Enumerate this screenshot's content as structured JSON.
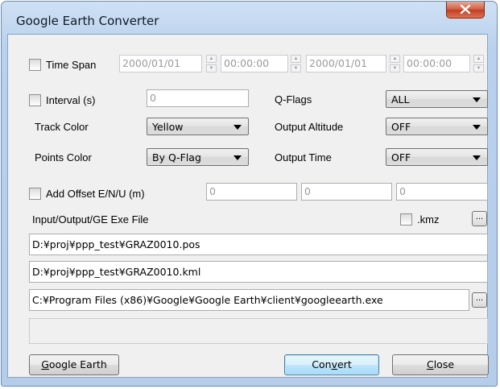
{
  "window": {
    "title": "Google Earth Converter",
    "close_icon": "close-icon"
  },
  "time_span": {
    "label": "Time Span",
    "checked": false,
    "start_date": "2000/01/01",
    "start_time": "00:00:00",
    "end_date": "2000/01/01",
    "end_time": "00:00:00"
  },
  "interval": {
    "label": "Interval (s)",
    "checked": false,
    "value": "0"
  },
  "qflags": {
    "label": "Q-Flags",
    "value": "ALL"
  },
  "track_color": {
    "label": "Track Color",
    "value": "Yellow"
  },
  "output_altitude": {
    "label": "Output Altitude",
    "value": "OFF"
  },
  "points_color": {
    "label": "Points Color",
    "value": "By Q-Flag"
  },
  "output_time": {
    "label": "Output Time",
    "value": "OFF"
  },
  "offset": {
    "label": "Add Offset E/N/U (m)",
    "checked": false,
    "e": "0",
    "n": "0",
    "u": "0"
  },
  "files": {
    "label": "Input/Output/GE Exe File",
    "kmz_label": ".kmz",
    "kmz_checked": false,
    "browse_label": "...",
    "input_file": "D:¥proj¥ppp_test¥GRAZ0010.pos",
    "output_file": "D:¥proj¥ppp_test¥GRAZ0010.kml",
    "ge_exe": "C:¥Program Files (x86)¥Google¥Google Earth¥client¥googleearth.exe"
  },
  "status_text": "",
  "buttons": {
    "google_earth": {
      "mnemonic": "G",
      "rest": "oogle Earth"
    },
    "convert": {
      "pre": "Con",
      "mnemonic": "v",
      "rest": "ert"
    },
    "close": {
      "mnemonic": "C",
      "rest": "lose"
    }
  },
  "colors": {
    "titlebar": "#b9d1ec",
    "close_button": "#c23c1f",
    "default_button": "#bee6fd",
    "dialog_bg": "#f0f0f0"
  }
}
